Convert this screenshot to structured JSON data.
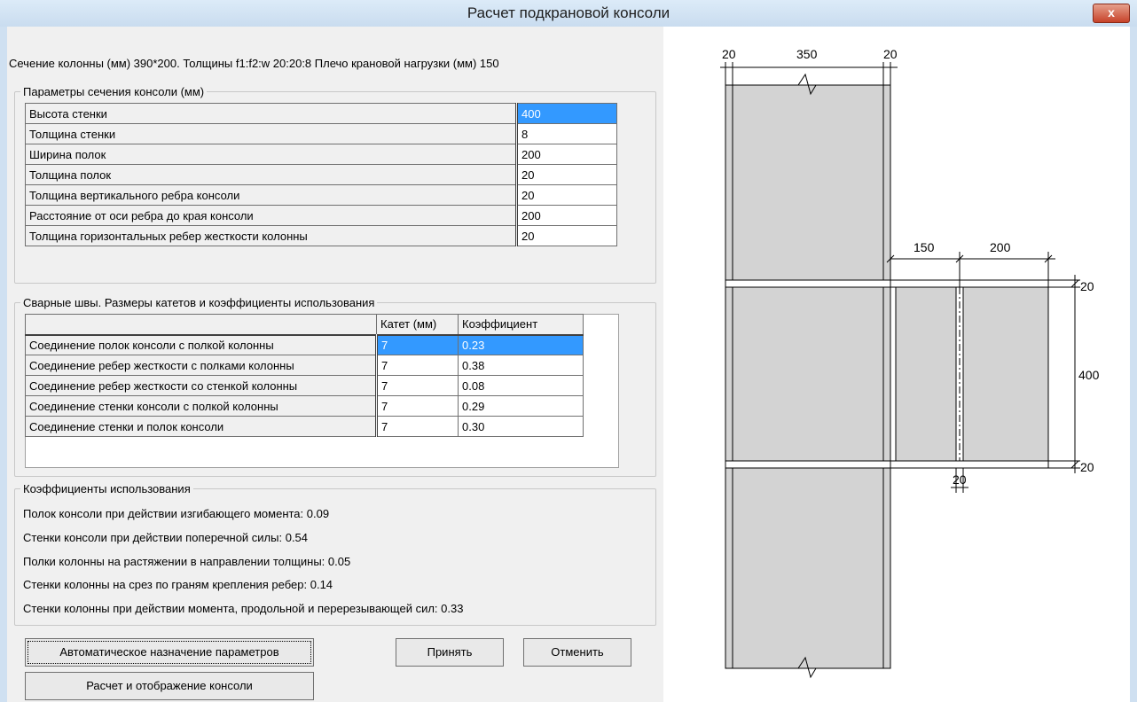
{
  "window": {
    "title": "Расчет подкрановой консоли",
    "close_label": "x"
  },
  "section_info": "Сечение колонны (мм) 390*200. Толщины f1:f2:w 20:20:8  Плечо крановой нагрузки (мм) 150",
  "params": {
    "legend": "Параметры сечения консоли (мм)",
    "rows": [
      {
        "label": "Высота стенки",
        "value": "400"
      },
      {
        "label": "Толщина стенки",
        "value": "8"
      },
      {
        "label": "Ширина полок",
        "value": "200"
      },
      {
        "label": "Толщина полок",
        "value": "20"
      },
      {
        "label": "Толщина вертикального ребра консоли",
        "value": "20"
      },
      {
        "label": "Расстояние от оси ребра до края консоли",
        "value": "200"
      },
      {
        "label": "Толщина горизонтальных ребер жесткости колонны",
        "value": "20"
      }
    ]
  },
  "welds": {
    "legend": "Сварные швы. Размеры катетов и коэффициенты использования",
    "headers": {
      "leg": "Катет (мм)",
      "coef": "Коэффициент"
    },
    "rows": [
      {
        "label": "Соединение полок консоли с полкой колонны",
        "leg": "7",
        "coef": "0.23"
      },
      {
        "label": "Соединение ребер жесткости с полками колонны",
        "leg": "7",
        "coef": "0.38"
      },
      {
        "label": "Соединение ребер жесткости со стенкой колонны",
        "leg": "7",
        "coef": "0.08"
      },
      {
        "label": "Соединение стенки консоли с полкой колонны",
        "leg": "7",
        "coef": "0.29"
      },
      {
        "label": "Соединение стенки и полок консоли",
        "leg": "7",
        "coef": "0.30"
      }
    ]
  },
  "usage": {
    "legend": "Коэффициенты использования",
    "lines": [
      "Полок консоли при действии изгибающего момента: 0.09",
      "Стенки консоли при действии поперечной силы: 0.54",
      "Полки колонны на растяжении в направлении толщины: 0.05",
      "Стенки колонны на срез по граням крепления ребер: 0.14",
      "Стенки колонны при действии момента, продольной и перерезывающей сил: 0.33"
    ]
  },
  "buttons": {
    "auto": "Автоматическое назначение параметров",
    "calc": "Расчет и отображение консоли",
    "accept": "Принять",
    "cancel": "Отменить"
  },
  "drawing": {
    "dims": {
      "top_left_flange": "20",
      "top_width": "350",
      "top_right_flange": "20",
      "arm": "150",
      "console_width": "200",
      "top_rib": "20",
      "height": "400",
      "bottom_rib": "20",
      "vert_rib": "20"
    }
  }
}
